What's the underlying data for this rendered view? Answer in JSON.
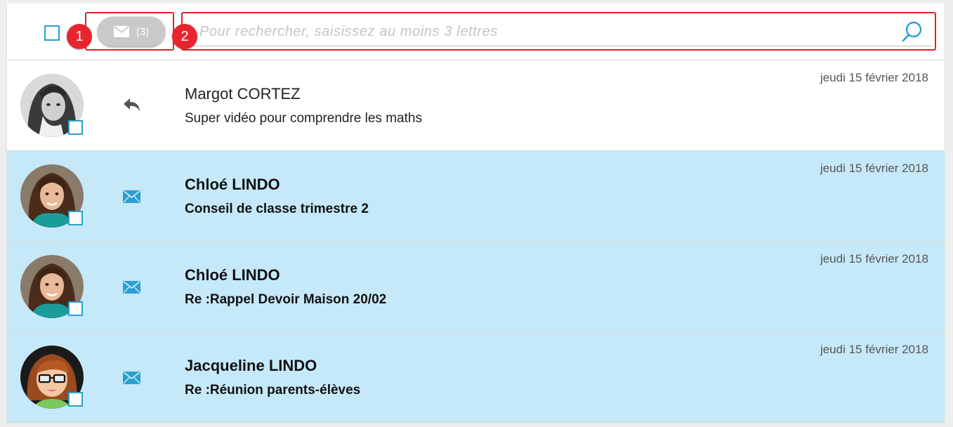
{
  "toolbar": {
    "unread_count": "(3)",
    "search_placeholder": "Pour rechercher, saisissez au moins 3 lettres"
  },
  "annotations": [
    "1",
    "2"
  ],
  "colors": {
    "accent": "#2a9fd0",
    "unread_bg": "#c6e9f9",
    "annotation": "#e8242f"
  },
  "messages": [
    {
      "sender": "Margot CORTEZ",
      "subject": "Super vidéo pour comprendre les maths",
      "date": "jeudi 15 février 2018",
      "status": "read",
      "icon": "reply-icon"
    },
    {
      "sender": "Chloé LINDO",
      "subject": "Conseil de classe trimestre 2",
      "date": "jeudi 15 février 2018",
      "status": "unread",
      "icon": "envelope-icon"
    },
    {
      "sender": "Chloé LINDO",
      "subject": "Re :Rappel Devoir Maison 20/02",
      "date": "jeudi 15 février 2018",
      "status": "unread",
      "icon": "envelope-icon"
    },
    {
      "sender": "Jacqueline LINDO",
      "subject": "Re :Réunion parents-élèves",
      "date": "jeudi 15 février 2018",
      "status": "unread",
      "icon": "envelope-icon"
    }
  ]
}
